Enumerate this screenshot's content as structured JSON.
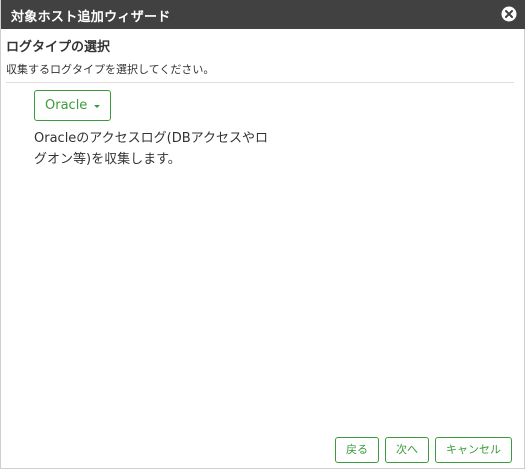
{
  "dialog": {
    "title": "対象ホスト追加ウィザード"
  },
  "section": {
    "title": "ログタイプの選択",
    "description": "収集するログタイプを選択してください。"
  },
  "log_type": {
    "selected": "Oracle",
    "description": "Oracleのアクセスログ(DBアクセスやログオン等)を収集します。"
  },
  "buttons": {
    "back_label": "戻る",
    "next_label": "次へ",
    "cancel_label": "キャンセル"
  },
  "colors": {
    "accent": "#3c9b3c",
    "titlebar": "#414141"
  },
  "icons": {
    "close": "close-circle-icon",
    "dropdown": "caret-down-icon"
  }
}
